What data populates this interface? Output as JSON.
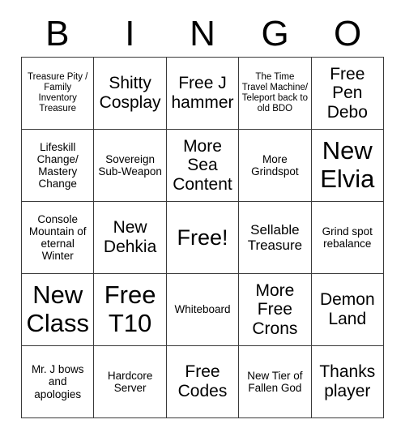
{
  "card": {
    "title_letters": [
      "B",
      "I",
      "N",
      "G",
      "O"
    ],
    "rows": [
      [
        {
          "text": "Treasure Pity / Family Inventory Treasure",
          "size": "xs"
        },
        {
          "text": "Shitty Cosplay",
          "size": "lg"
        },
        {
          "text": "Free J hammer",
          "size": "lg"
        },
        {
          "text": "The Time Travel Machine/ Teleport back to old BDO",
          "size": "xs"
        },
        {
          "text": "Free Pen Debo",
          "size": "lg"
        }
      ],
      [
        {
          "text": "Lifeskill Change/ Mastery Change",
          "size": "sm"
        },
        {
          "text": "Sovereign Sub-Weapon",
          "size": "sm"
        },
        {
          "text": "More Sea Content",
          "size": "lg"
        },
        {
          "text": "More Grindspot",
          "size": "sm"
        },
        {
          "text": "New Elvia",
          "size": "xxl"
        }
      ],
      [
        {
          "text": "Console Mountain of eternal Winter",
          "size": "sm"
        },
        {
          "text": "New Dehkia",
          "size": "lg"
        },
        {
          "text": "Free!",
          "size": "xl"
        },
        {
          "text": "Sellable Treasure",
          "size": "md"
        },
        {
          "text": "Grind spot rebalance",
          "size": "sm"
        }
      ],
      [
        {
          "text": "New Class",
          "size": "xxl"
        },
        {
          "text": "Free T10",
          "size": "xxl"
        },
        {
          "text": "Whiteboard",
          "size": "sm"
        },
        {
          "text": "More Free Crons",
          "size": "lg"
        },
        {
          "text": "Demon Land",
          "size": "lg"
        }
      ],
      [
        {
          "text": "Mr. J bows and apologies",
          "size": "sm"
        },
        {
          "text": "Hardcore Server",
          "size": "sm"
        },
        {
          "text": "Free Codes",
          "size": "lg"
        },
        {
          "text": "New Tier of Fallen God",
          "size": "sm"
        },
        {
          "text": "Thanks player",
          "size": "lg"
        }
      ]
    ],
    "colors": {
      "background": "#ffffff",
      "text": "#000000",
      "grid_line": "#3a3a3a"
    }
  }
}
